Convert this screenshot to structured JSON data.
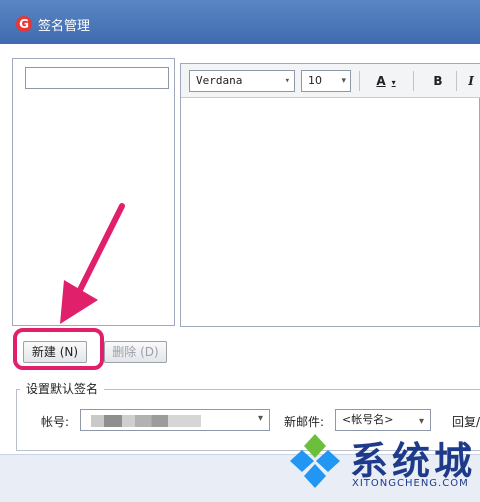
{
  "window": {
    "title": "签名管理",
    "app_icon_glyph": "G"
  },
  "editor": {
    "font_family": "Verdana",
    "font_size": "10",
    "color_button": "A",
    "bold_button": "B",
    "italic_button": "I"
  },
  "buttons": {
    "new_label": "新建 (N)",
    "delete_label": "删除 (D)"
  },
  "default_signature": {
    "group_title": "设置默认签名",
    "account_label": "帐号:",
    "new_mail_label": "新邮件:",
    "new_mail_value": "<帐号名>",
    "reply_label": "回复/"
  },
  "watermark": {
    "main": "系统城",
    "sub": "XITONGCHENG.COM"
  },
  "colors": {
    "highlight": "#e0206a",
    "titlebar": "#4a76b8",
    "watermark": "#1e3a8a"
  }
}
